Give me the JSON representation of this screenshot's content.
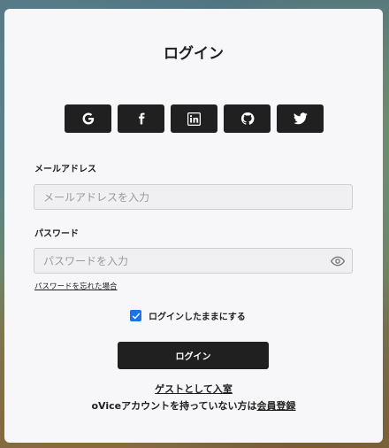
{
  "modal": {
    "title": "ログイン"
  },
  "social": [
    {
      "name": "google",
      "icon": "google-icon"
    },
    {
      "name": "facebook",
      "icon": "facebook-icon"
    },
    {
      "name": "linkedin",
      "icon": "linkedin-icon"
    },
    {
      "name": "github",
      "icon": "github-icon"
    },
    {
      "name": "twitter",
      "icon": "twitter-icon"
    }
  ],
  "email": {
    "label": "メールアドレス",
    "placeholder": "メールアドレスを入力",
    "value": ""
  },
  "password": {
    "label": "パスワード",
    "placeholder": "パスワードを入力",
    "value": "",
    "visibility_icon": "eye-icon"
  },
  "forgot_password": "パスワードを忘れた場合",
  "remember_me": {
    "label": "ログインしたままにする",
    "checked": true
  },
  "login_button": "ログイン",
  "guest_link": "ゲストとして入室",
  "signup": {
    "prefix": "oViceアカウントを持っていない方は",
    "link": "会員登録"
  },
  "colors": {
    "button_bg": "#202020",
    "checkbox_accent": "#1a73e8",
    "modal_bg": "#f7f7f9"
  }
}
